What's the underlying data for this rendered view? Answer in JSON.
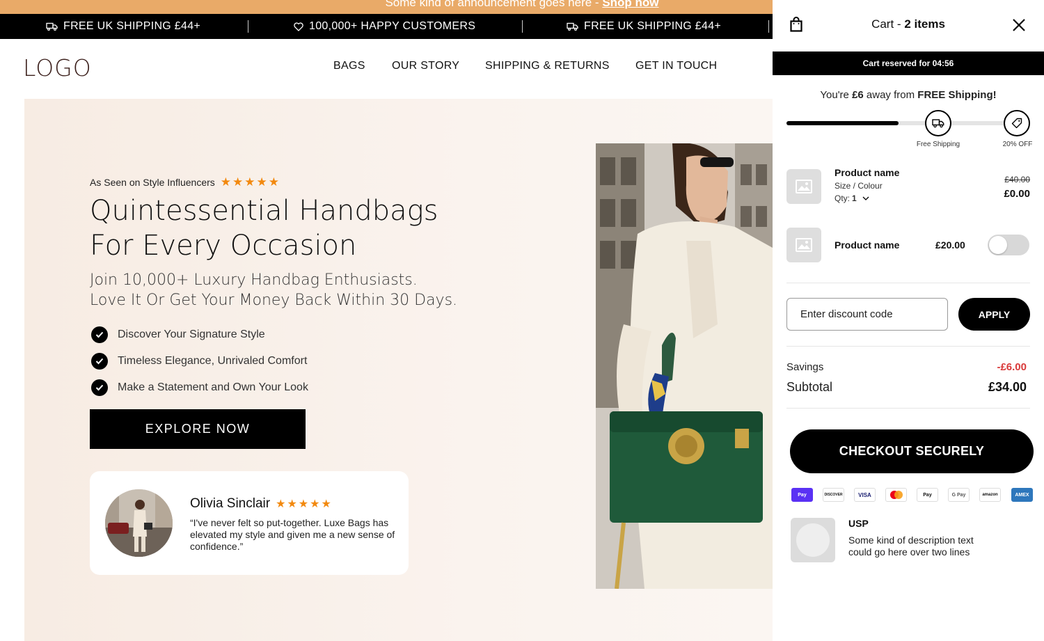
{
  "announcement": {
    "text": "Some kind of announcement goes here -",
    "link": "Shop now"
  },
  "ticker": [
    {
      "icon": "truck-icon",
      "label": "FREE UK SHIPPING £44+"
    },
    {
      "icon": "heart-icon",
      "label": "100,000+ HAPPY CUSTOMERS"
    },
    {
      "icon": "truck-icon",
      "label": "FREE UK SHIPPING £44+"
    }
  ],
  "header": {
    "logo": "LOGO",
    "nav": [
      "BAGS",
      "OUR STORY",
      "SHIPPING & RETURNS",
      "GET IN TOUCH"
    ]
  },
  "hero": {
    "seen": "As Seen on Style Influencers",
    "stars": "★★★★★",
    "headline_1": "Quintessential Handbags",
    "headline_2": "For Every Occasion",
    "sub_1": "Join 10,000+ Luxury Handbag Enthusiasts.",
    "sub_2": "Love It Or Get Your Money Back Within 30 Days.",
    "bullets": [
      "Discover Your Signature Style",
      "Timeless Elegance, Unrivaled Comfort",
      "Make a Statement and Own Your Look"
    ],
    "cta": "EXPLORE NOW",
    "review": {
      "name": "Olivia Sinclair",
      "stars": "★★★★★",
      "text": "“I've never felt so put-together. Luxe Bags has elevated my style and given me a new sense of confidence.”"
    }
  },
  "cart": {
    "title": "Cart - ",
    "count": "2 items",
    "reserved": "Cart reserved for 04:56",
    "away_prefix": "You're ",
    "away_amount": "£6",
    "away_mid": " away from ",
    "away_goal": "FREE Shipping!",
    "progress": 0.46,
    "milestones": [
      {
        "label": "Free Shipping",
        "icon": "truck-icon"
      },
      {
        "label": "20% OFF",
        "icon": "tag-icon"
      }
    ],
    "items": [
      {
        "name": "Product name",
        "variant": "Size / Colour",
        "qty_label": "Qty:",
        "qty": "1",
        "old_price": "£40.00",
        "price": "£0.00"
      },
      {
        "name": "Product name",
        "price": "£20.00",
        "toggle": false
      }
    ],
    "discount_placeholder": "Enter discount code",
    "apply": "APPLY",
    "savings_label": "Savings",
    "savings": "-£6.00",
    "subtotal_label": "Subtotal",
    "subtotal": "£34.00",
    "checkout": "CHECKOUT SECURELY",
    "payments": [
      "Pay",
      "DISCOVER",
      "VISA",
      "mastercard",
      "Pay",
      "G Pay",
      "amazon",
      "AMEX"
    ],
    "usp_title": "USP",
    "usp_text_1": "Some kind of description text",
    "usp_text_2": "could go here over two lines",
    "colors": {
      "accent": "#e9aa68",
      "savings": "#d93a3a",
      "star": "#f2890f"
    }
  }
}
